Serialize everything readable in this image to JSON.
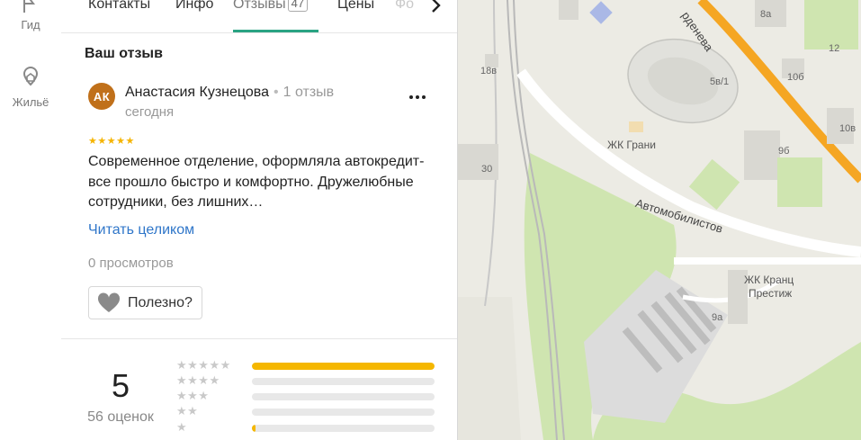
{
  "rail": {
    "items": [
      {
        "label": "Гид",
        "icon": "guide-icon"
      },
      {
        "label": "Жильё",
        "icon": "housing-icon"
      }
    ]
  },
  "tabs": [
    {
      "label": "Контакты"
    },
    {
      "label": "Инфо"
    },
    {
      "label": "Отзывы",
      "count": "47",
      "active": true
    },
    {
      "label": "Цены"
    },
    {
      "label": "Фо"
    }
  ],
  "review": {
    "section_title": "Ваш отзыв",
    "avatar_initials": "АК",
    "author": "Анастасия Кузнецова",
    "separator": "•",
    "author_reviews": "1 отзыв",
    "date": "сегодня",
    "stars": "★★★★★",
    "text": "Современное отделение, оформляла автокредит- все прошло быстро и комфортно. Дружелюбные сотрудники, без лишних…",
    "read_more": "Читать целиком",
    "views": "0 просмотров",
    "useful": "Полезно?"
  },
  "rating": {
    "value": "5",
    "count": "56 оценок",
    "distribution": [
      {
        "stars": "★★★★★",
        "fraction": 1.0
      },
      {
        "stars": "★★★★",
        "fraction": 0.0
      },
      {
        "stars": "★★★",
        "fraction": 0.0
      },
      {
        "stars": "★★",
        "fraction": 0.0
      },
      {
        "stars": "★",
        "fraction": 0.02
      }
    ],
    "bar_color": "#f5b700"
  },
  "map": {
    "labels": {
      "grani": "ЖК Грани",
      "street": "Автомобилистов",
      "street2": "рденева",
      "kranz": "ЖК Кранц",
      "prestige": "Престиж"
    },
    "numbers": [
      "18в",
      "30",
      "8а",
      "12",
      "5в/1",
      "10б",
      "9б",
      "9а",
      "10в"
    ]
  },
  "colors": {
    "accent": "#2aa383",
    "link": "#2f76c9",
    "avatar": "#c0701a",
    "road": "#f5a623"
  }
}
